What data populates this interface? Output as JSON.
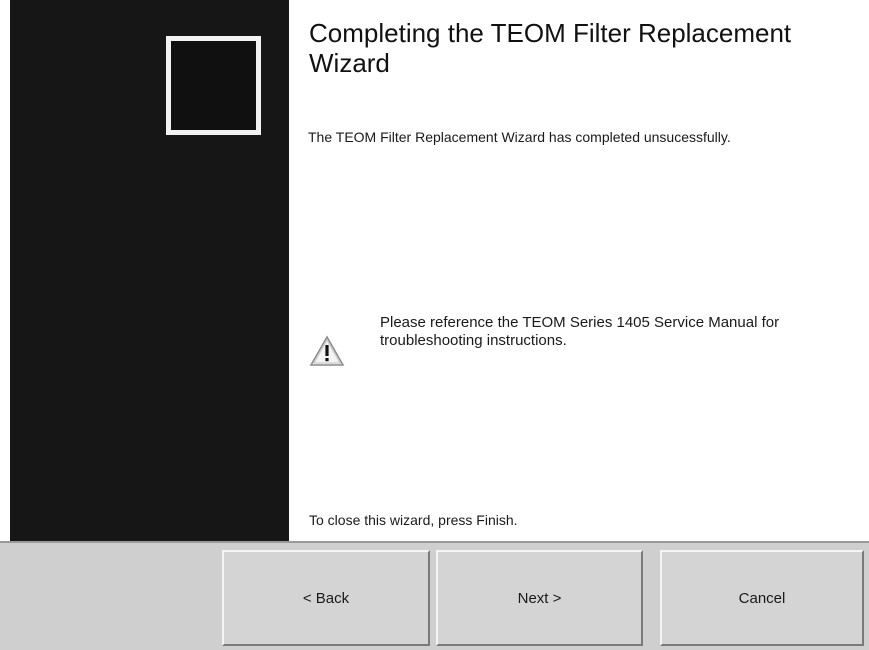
{
  "wizard": {
    "title": "Completing the TEOM Filter Replacement Wizard",
    "status_message": "The TEOM Filter Replacement Wizard has completed unsucessfully.",
    "warning_message": "Please reference the TEOM Series 1405 Service Manual for troubleshooting instructions.",
    "warning_icon": "warning-triangle-icon",
    "close_hint": "To close this wizard, press Finish."
  },
  "buttons": {
    "back_label": "< Back",
    "next_label": "Next >",
    "cancel_label": "Cancel"
  },
  "colors": {
    "side_panel": "#161616",
    "button_face": "#d4d4d4",
    "button_bar": "#cfcfcf"
  }
}
